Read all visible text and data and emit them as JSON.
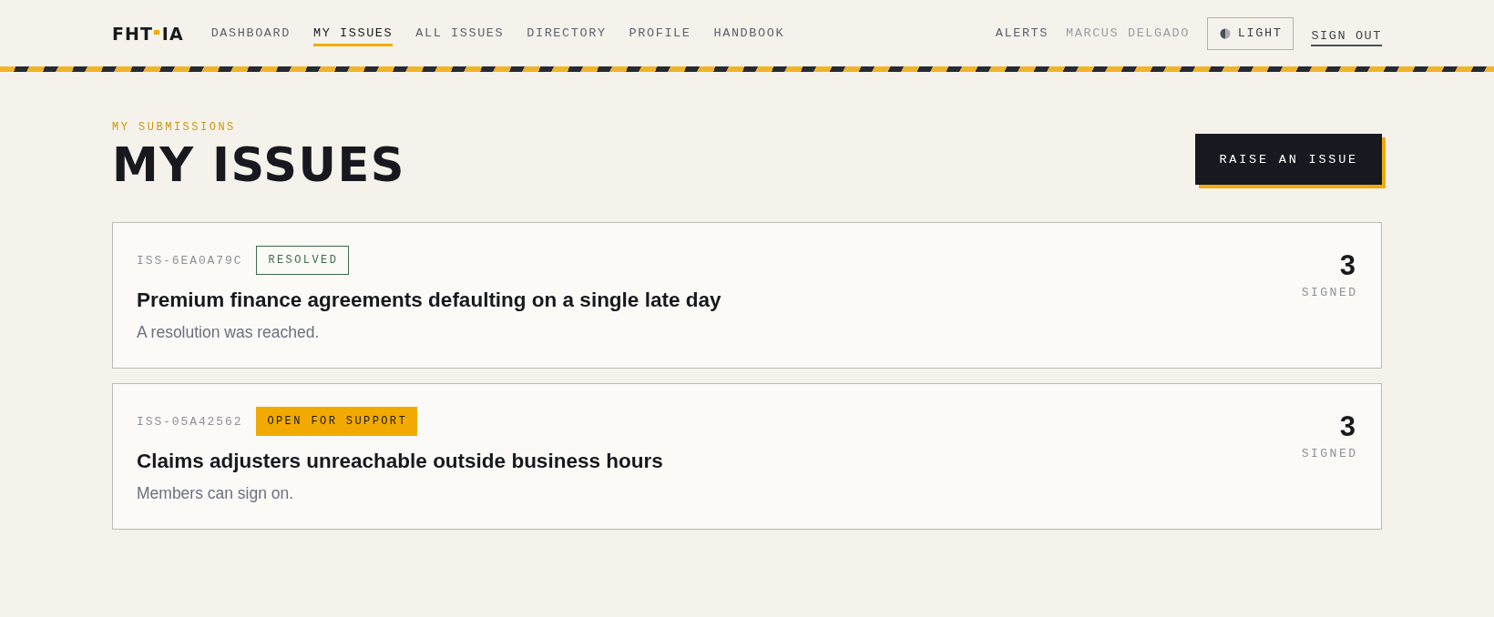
{
  "header": {
    "logo": [
      "FHT",
      "IA"
    ],
    "nav": [
      {
        "label": "DASHBOARD",
        "selected": false
      },
      {
        "label": "MY ISSUES",
        "selected": true
      },
      {
        "label": "ALL ISSUES",
        "selected": false
      },
      {
        "label": "DIRECTORY",
        "selected": false
      },
      {
        "label": "PROFILE",
        "selected": false
      },
      {
        "label": "HANDBOOK",
        "selected": false
      }
    ],
    "alerts": "ALERTS",
    "user": "MARCUS DELGADO",
    "theme_button": "LIGHT",
    "sign_out": "SIGN OUT"
  },
  "page": {
    "eyebrow": "MY SUBMISSIONS",
    "title": "MY ISSUES",
    "action": "RAISE AN ISSUE"
  },
  "issues": [
    {
      "id": "ISS-6EA0A79C",
      "status": {
        "label": "RESOLVED",
        "kind": "resolved"
      },
      "title": "Premium finance agreements defaulting on a single late day",
      "summary": "A resolution was reached.",
      "count": "3",
      "count_label": "SIGNED"
    },
    {
      "id": "ISS-05A42562",
      "status": {
        "label": "OPEN FOR SUPPORT",
        "kind": "open"
      },
      "title": "Claims adjusters unreachable outside business hours",
      "summary": "Members can sign on.",
      "count": "3",
      "count_label": "SIGNED"
    }
  ]
}
